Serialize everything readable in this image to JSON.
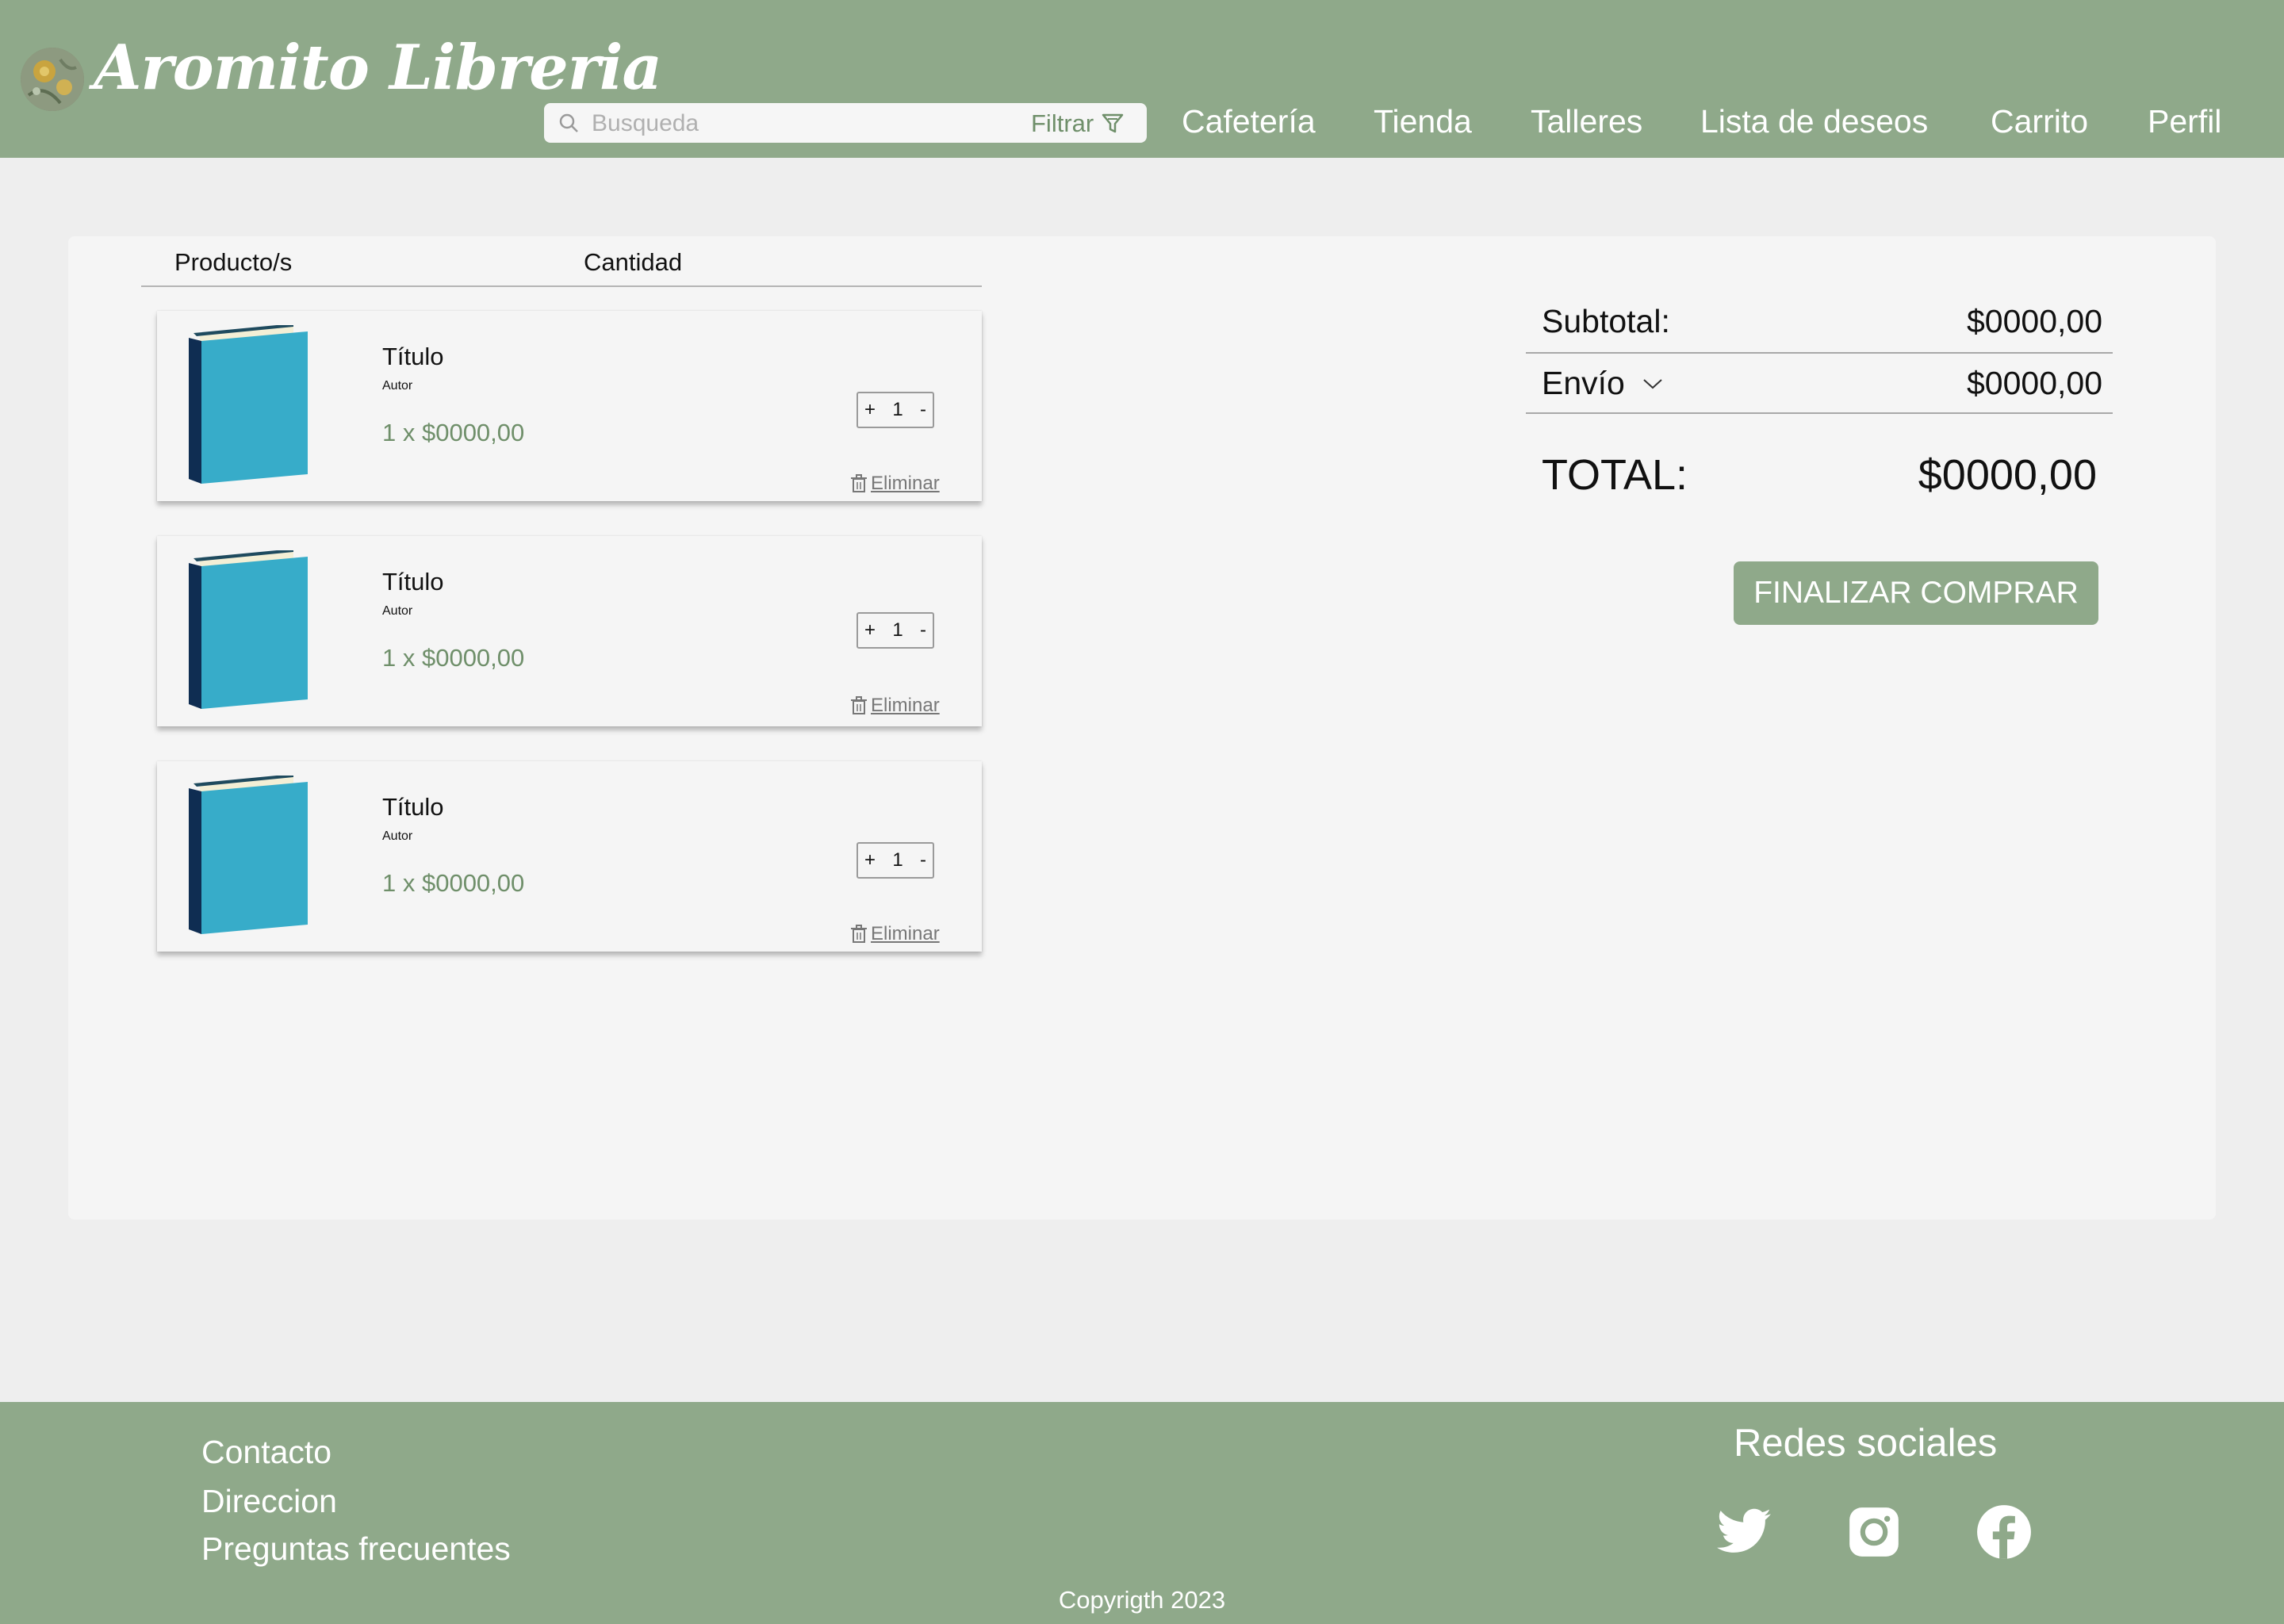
{
  "header": {
    "brand": "Aromito Libreria",
    "search_placeholder": "Busqueda",
    "filter_label": "Filtrar",
    "nav": [
      "Cafetería",
      "Tienda",
      "Talleres",
      "Lista de deseos",
      "Carrito",
      "Perfil"
    ]
  },
  "cart": {
    "col_product": "Producto/s",
    "col_quantity": "Cantidad",
    "items": [
      {
        "title": "Título",
        "author": "Autor",
        "price": "1 x $0000,00",
        "qty": "1",
        "plus": "+",
        "minus": "-",
        "delete": "Eliminar"
      },
      {
        "title": "Título",
        "author": "Autor",
        "price": "1 x $0000,00",
        "qty": "1",
        "plus": "+",
        "minus": "-",
        "delete": "Eliminar"
      },
      {
        "title": "Título",
        "author": "Autor",
        "price": "1 x $0000,00",
        "qty": "1",
        "plus": "+",
        "minus": "-",
        "delete": "Eliminar"
      }
    ]
  },
  "summary": {
    "subtotal_label": "Subtotal:",
    "subtotal_value": "$0000,00",
    "shipping_label": "Envío",
    "shipping_value": "$0000,00",
    "total_label": "TOTAL:",
    "total_value": "$0000,00",
    "checkout_label": "FINALIZAR COMPRAR"
  },
  "footer": {
    "links": [
      "Contacto",
      "Direccion",
      "Preguntas frecuentes"
    ],
    "copyright": "Copyrigth 2023",
    "social_title": "Redes sociales",
    "social_icons": [
      "twitter-icon",
      "instagram-icon",
      "facebook-icon"
    ]
  },
  "colors": {
    "brand_green": "#8fa98a",
    "price_green": "#6f8f6a",
    "book_blue": "#37acc9",
    "book_spine": "#0f2d52"
  }
}
